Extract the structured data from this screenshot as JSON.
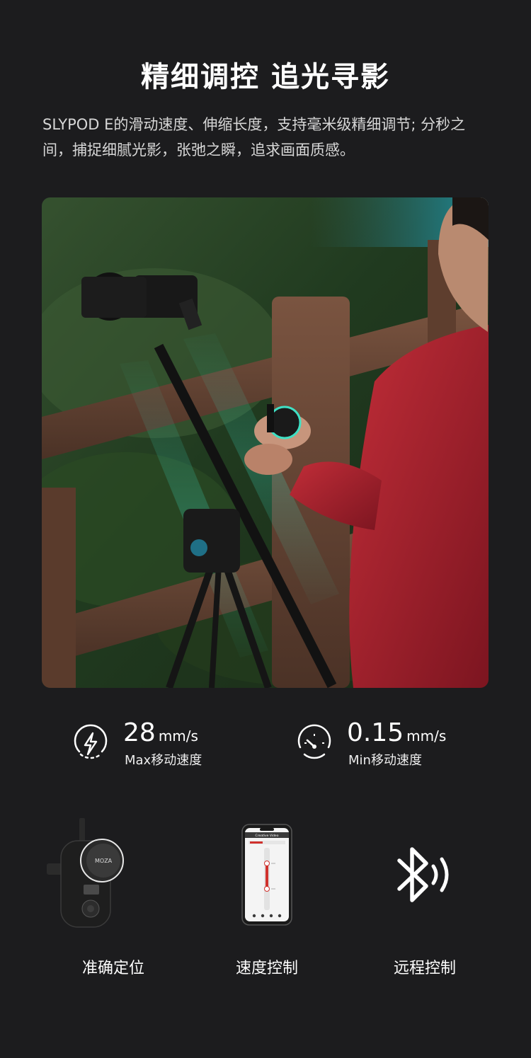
{
  "header": {
    "title": "精细调控 追光寻影",
    "description": "SLYPOD E的滑动速度、伸缩长度，支持毫米级精细调节; 分秒之间，捕捉细腻光影，张弛之瞬，追求画面质感。"
  },
  "stats": [
    {
      "icon": "lightning-icon",
      "value": "28",
      "unit": "mm/s",
      "label": "Max移动速度"
    },
    {
      "icon": "speedometer-icon",
      "value": "0.15",
      "unit": "mm/s",
      "label": "Min移动速度"
    }
  ],
  "features": [
    {
      "icon": "controller-icon",
      "label": "准确定位",
      "brand": "MOZA"
    },
    {
      "icon": "phone-app-icon",
      "label": "速度控制",
      "app_title": "Creative Video"
    },
    {
      "icon": "bluetooth-icon",
      "label": "远程控制"
    }
  ],
  "colors": {
    "background": "#1c1c1e",
    "jacket_red": "#a5222e",
    "accent_teal": "#3fe0c4",
    "app_red": "#d0312d"
  }
}
